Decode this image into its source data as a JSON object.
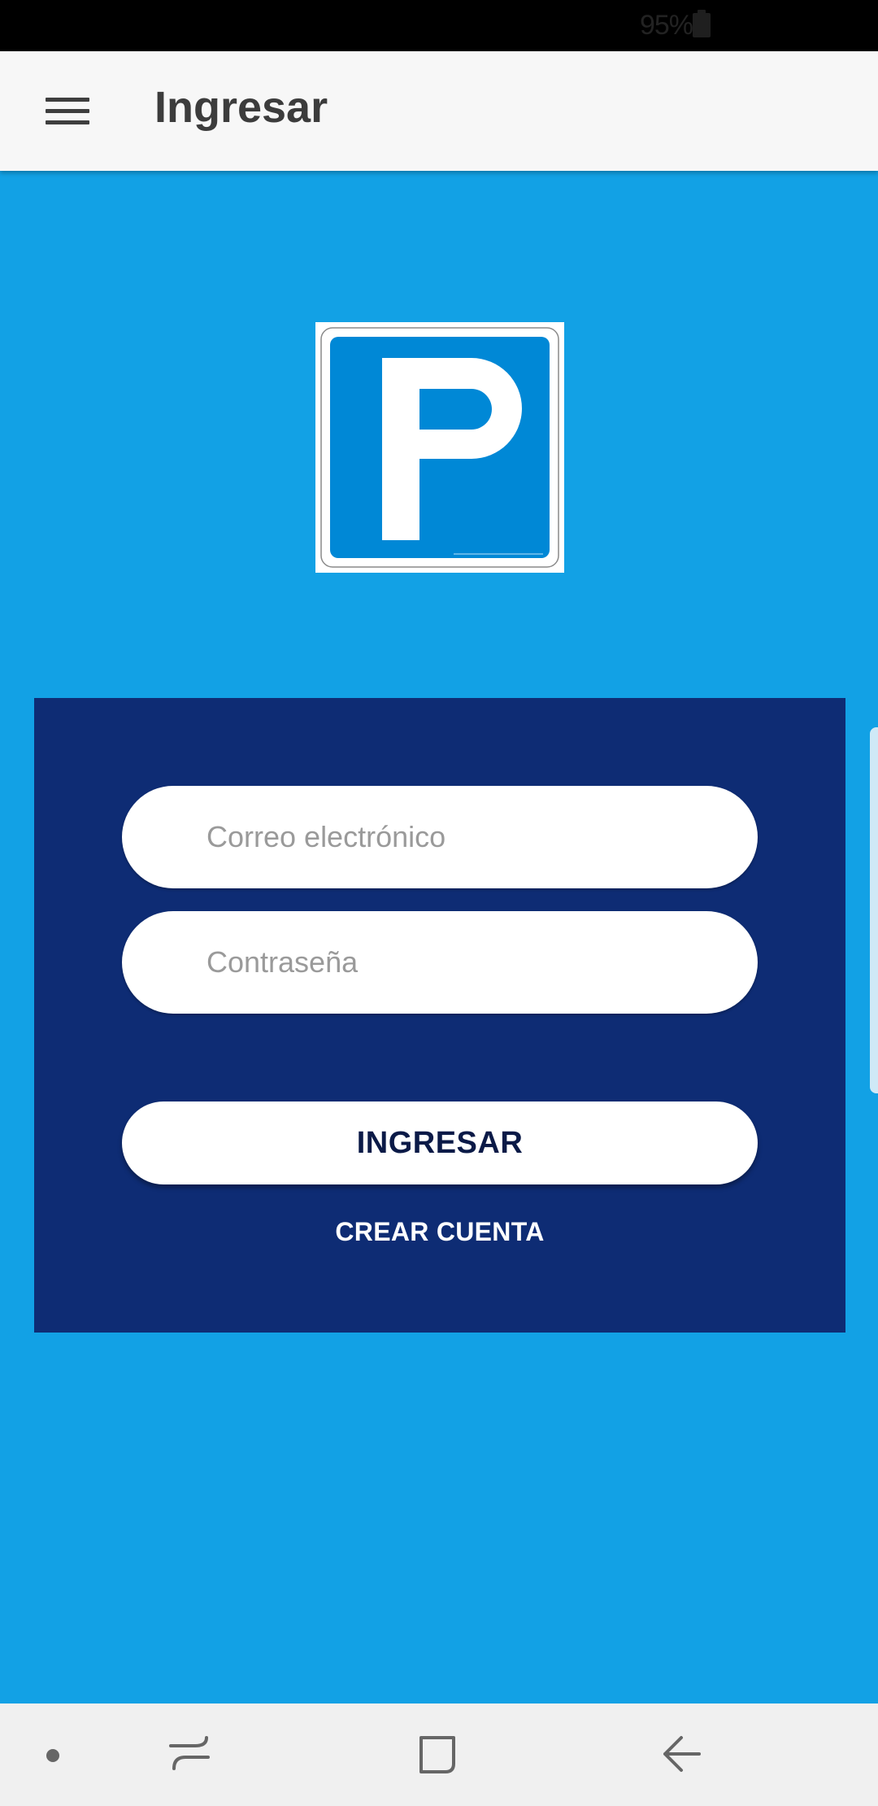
{
  "status_bar": {
    "battery_percent": "95%"
  },
  "app_bar": {
    "title": "Ingresar",
    "menu_icon": "hamburger-menu-icon"
  },
  "logo": {
    "letter": "P",
    "colors": {
      "outer": "#ffffff",
      "inner": "#0088d6",
      "letter": "#ffffff"
    }
  },
  "login": {
    "email_placeholder": "Correo electrónico",
    "email_value": "",
    "password_placeholder": "Contraseña",
    "password_value": "",
    "submit_label": "INGRESAR",
    "create_account_label": "CREAR CUENTA"
  },
  "navigation": {
    "dot_icon": "nav-dot-icon",
    "recents_icon": "recents-icon",
    "home_icon": "home-icon",
    "back_icon": "back-icon"
  },
  "colors": {
    "background": "#12a1e5",
    "panel": "#0e2c74",
    "app_bar": "#f7f7f7",
    "button_text": "#0b1a47"
  }
}
